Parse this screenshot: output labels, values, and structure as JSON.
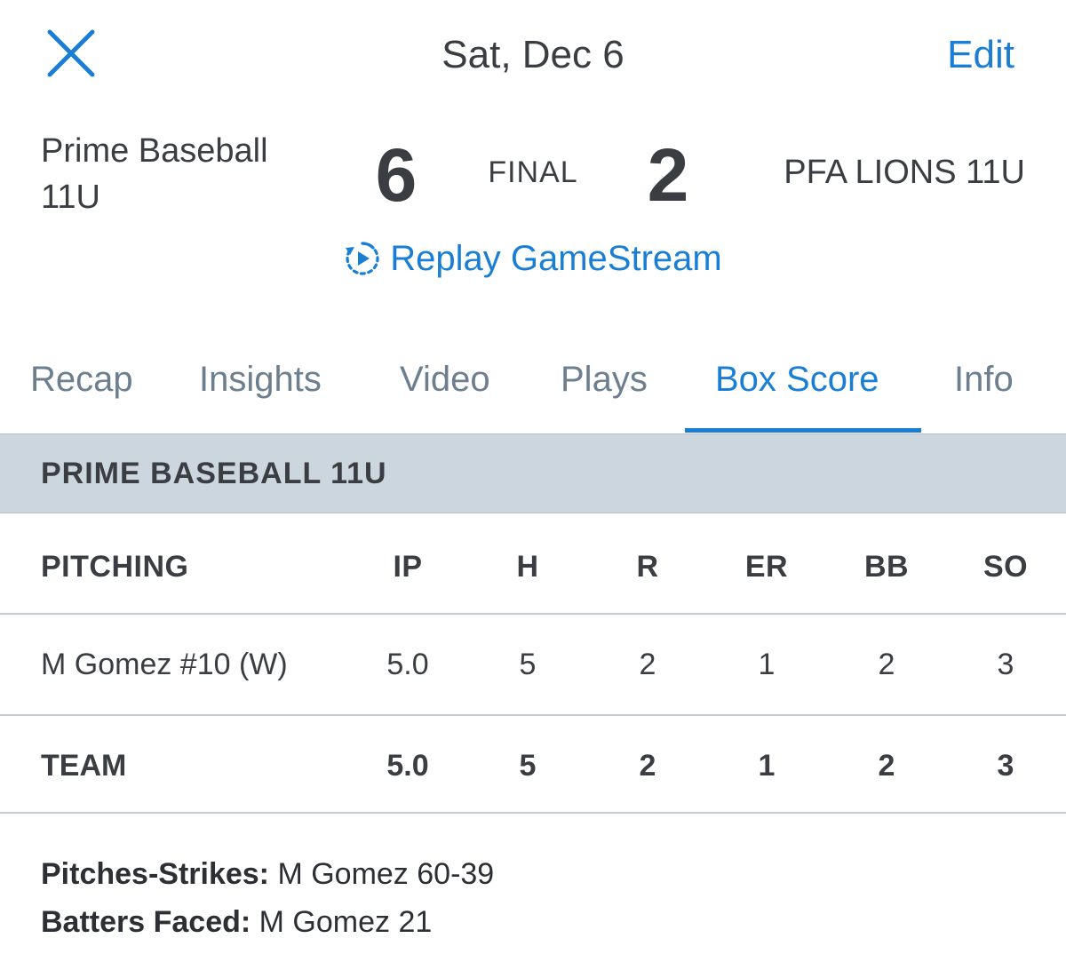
{
  "header": {
    "title": "Sat, Dec 6",
    "edit_label": "Edit",
    "close_icon": "close-icon"
  },
  "game": {
    "home_team": "Prime Baseball 11U",
    "home_score": "6",
    "status": "FINAL",
    "away_score": "2",
    "away_team": "PFA LIONS 11U",
    "replay_label": "Replay GameStream",
    "replay_icon": "replay-play-icon"
  },
  "tabs": [
    {
      "label": "Recap"
    },
    {
      "label": "Insights"
    },
    {
      "label": "Video"
    },
    {
      "label": "Plays"
    },
    {
      "label": "Box Score",
      "active": true
    },
    {
      "label": "Info"
    }
  ],
  "box_score": {
    "team_header": "PRIME BASEBALL 11U",
    "columns": [
      "PITCHING",
      "IP",
      "H",
      "R",
      "ER",
      "BB",
      "SO"
    ],
    "rows": [
      {
        "name": "M Gomez #10 (W)",
        "ip": "5.0",
        "h": "5",
        "r": "2",
        "er": "1",
        "bb": "2",
        "so": "3"
      }
    ],
    "totals": {
      "name": "TEAM",
      "ip": "5.0",
      "h": "5",
      "r": "2",
      "er": "1",
      "bb": "2",
      "so": "3"
    }
  },
  "notes": [
    {
      "label": "Pitches-Strikes:",
      "value": " M Gomez 60-39"
    },
    {
      "label": "Batters Faced:",
      "value": " M Gomez 21"
    }
  ],
  "colors": {
    "accent": "#1a7fd4",
    "text": "#3a3d42",
    "tab_inactive": "#6d7f8f",
    "section_bg": "#ccd6de"
  }
}
